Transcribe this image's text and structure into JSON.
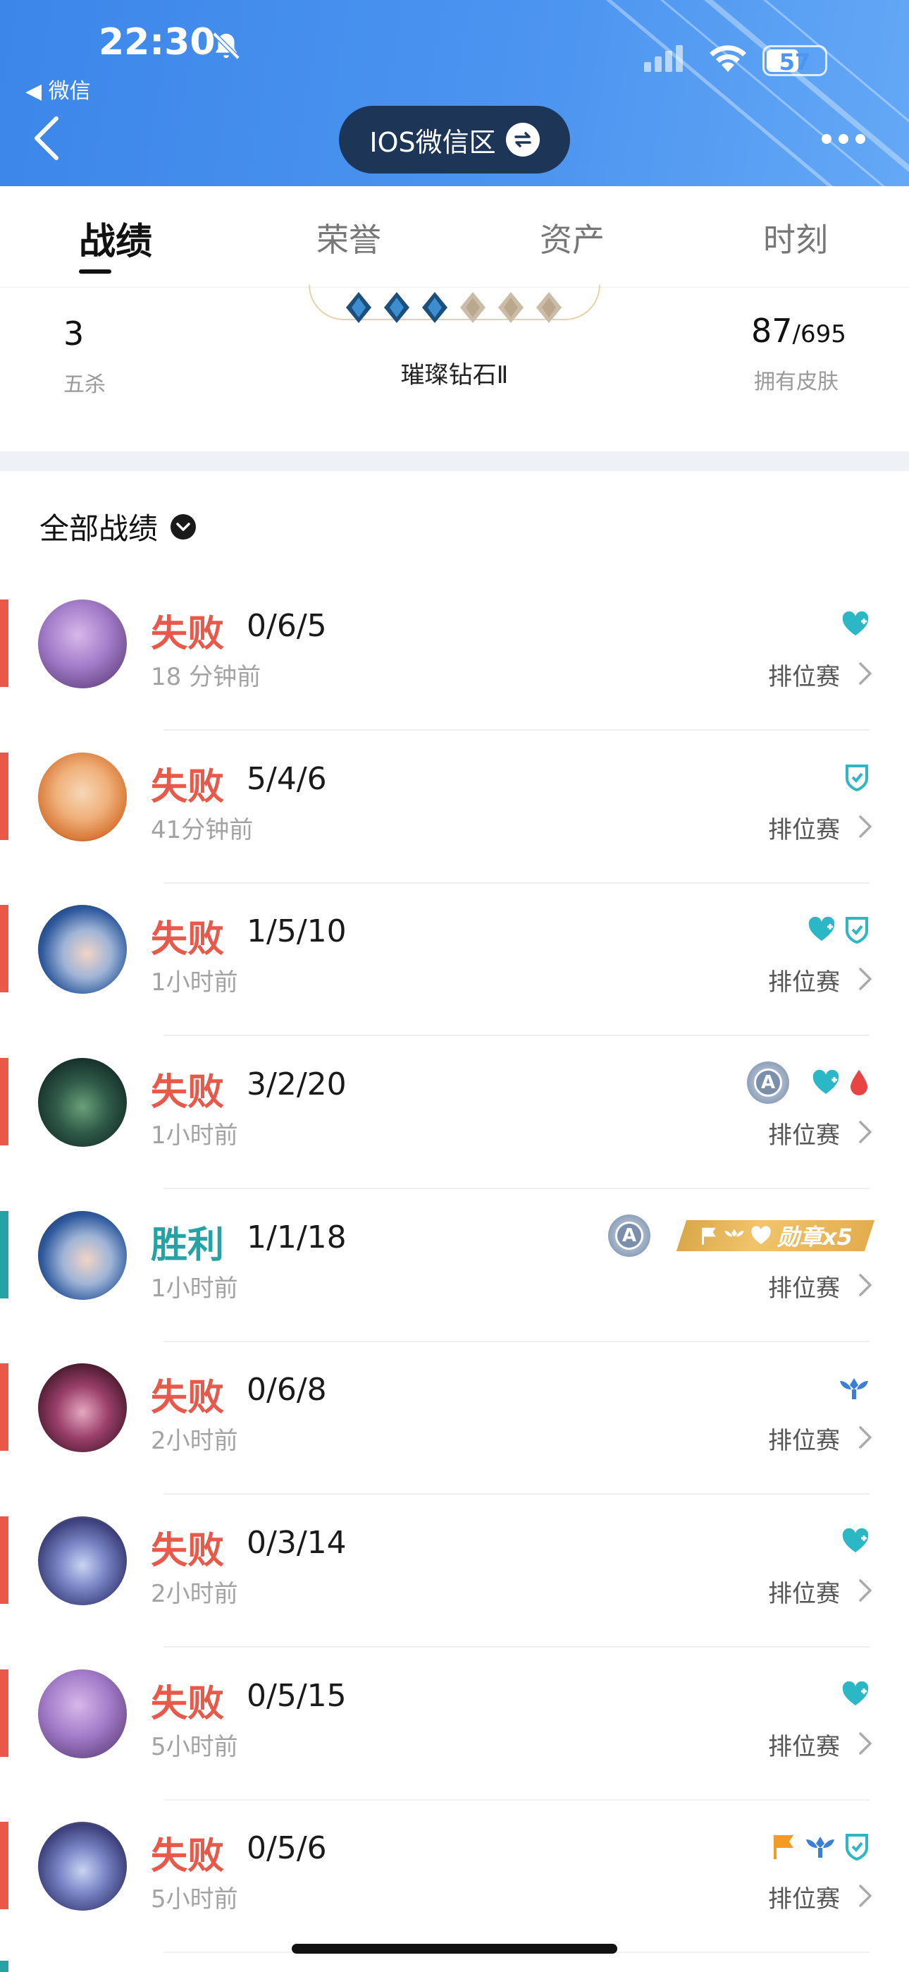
{
  "status": {
    "time": "22:30",
    "back_app": "◀ 微信",
    "battery": "57"
  },
  "nav": {
    "server": "IOS微信区"
  },
  "tabs": [
    "战绩",
    "荣誉",
    "资产",
    "时刻"
  ],
  "stats": {
    "left_value": "3",
    "left_label": "五杀",
    "rank_name": "璀璨钻石Ⅱ",
    "skins_owned": "87",
    "skins_total": "/695",
    "skins_label": "拥有皮肤"
  },
  "filter": {
    "label": "全部战绩"
  },
  "matches": [
    {
      "result": "失败",
      "kda": "0/6/5",
      "time": "18 分钟前",
      "mode": "排位赛",
      "avatar": "purple-hero"
    },
    {
      "result": "失败",
      "kda": "5/4/6",
      "time": "41分钟前",
      "mode": "排位赛",
      "avatar": "blonde-hero"
    },
    {
      "result": "失败",
      "kda": "1/5/10",
      "time": "1小时前",
      "mode": "排位赛",
      "avatar": "blue-hair-hero"
    },
    {
      "result": "失败",
      "kda": "3/2/20",
      "time": "1小时前",
      "mode": "排位赛",
      "avatar": "green-hero"
    },
    {
      "result": "胜利",
      "kda": "1/1/18",
      "time": "1小时前",
      "mode": "排位赛",
      "avatar": "blue-hair-hero",
      "medal": "勋章x5"
    },
    {
      "result": "失败",
      "kda": "0/6/8",
      "time": "2小时前",
      "mode": "排位赛",
      "avatar": "dark-hero"
    },
    {
      "result": "失败",
      "kda": "0/3/14",
      "time": "2小时前",
      "mode": "排位赛",
      "avatar": "cat-hero"
    },
    {
      "result": "失败",
      "kda": "0/5/15",
      "time": "5小时前",
      "mode": "排位赛",
      "avatar": "purple-hero"
    },
    {
      "result": "失败",
      "kda": "0/5/6",
      "time": "5小时前",
      "mode": "排位赛",
      "avatar": "cat-hero"
    }
  ],
  "colors": {
    "lose": "#e8594a",
    "win": "#24a3a5",
    "header": "#4c95f0",
    "teal_icon": "#2bb7c6"
  }
}
